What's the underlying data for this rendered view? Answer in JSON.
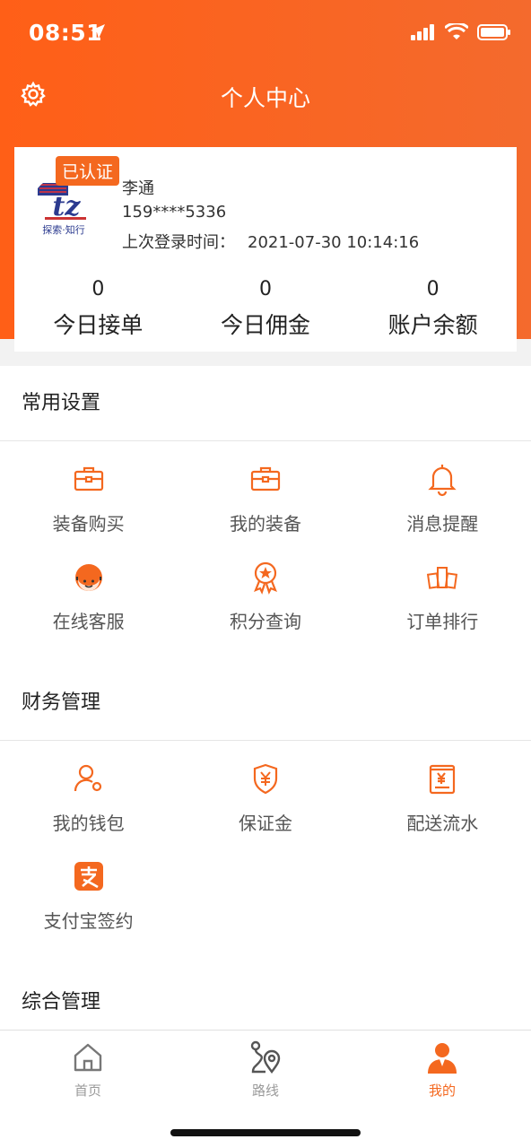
{
  "status": {
    "time": "08:51"
  },
  "nav": {
    "title": "个人中心"
  },
  "profile": {
    "verified": "已认证",
    "name": "李通",
    "phone": "159****5336",
    "last_login_label": "上次登录时间：",
    "last_login_value": "2021-07-30 10:14:16",
    "logo_text": "探索·知行",
    "stats": [
      {
        "value": "0",
        "label": "今日接单"
      },
      {
        "value": "0",
        "label": "今日佣金"
      },
      {
        "value": "0",
        "label": "账户余额"
      }
    ]
  },
  "sections": {
    "common": {
      "title": "常用设置",
      "items": [
        {
          "label": "装备购买",
          "icon": "briefcase-icon"
        },
        {
          "label": "我的装备",
          "icon": "briefcase-icon"
        },
        {
          "label": "消息提醒",
          "icon": "bell-icon"
        },
        {
          "label": "在线客服",
          "icon": "customer-service-icon"
        },
        {
          "label": "积分查询",
          "icon": "medal-icon"
        },
        {
          "label": "订单排行",
          "icon": "ranking-icon"
        }
      ]
    },
    "finance": {
      "title": "财务管理",
      "items": [
        {
          "label": "我的钱包",
          "icon": "user-gear-icon"
        },
        {
          "label": "保证金",
          "icon": "yuan-shield-icon"
        },
        {
          "label": "配送流水",
          "icon": "receipt-icon"
        },
        {
          "label": "支付宝签约",
          "icon": "alipay-icon"
        }
      ]
    },
    "general": {
      "title": "综合管理"
    }
  },
  "tabs": [
    {
      "label": "首页",
      "icon": "home-icon"
    },
    {
      "label": "路线",
      "icon": "route-icon"
    },
    {
      "label": "我的",
      "icon": "profile-icon"
    }
  ],
  "colors": {
    "accent": "#f4681f",
    "header_start": "#ff5f17",
    "header_end": "#f46a2d"
  }
}
